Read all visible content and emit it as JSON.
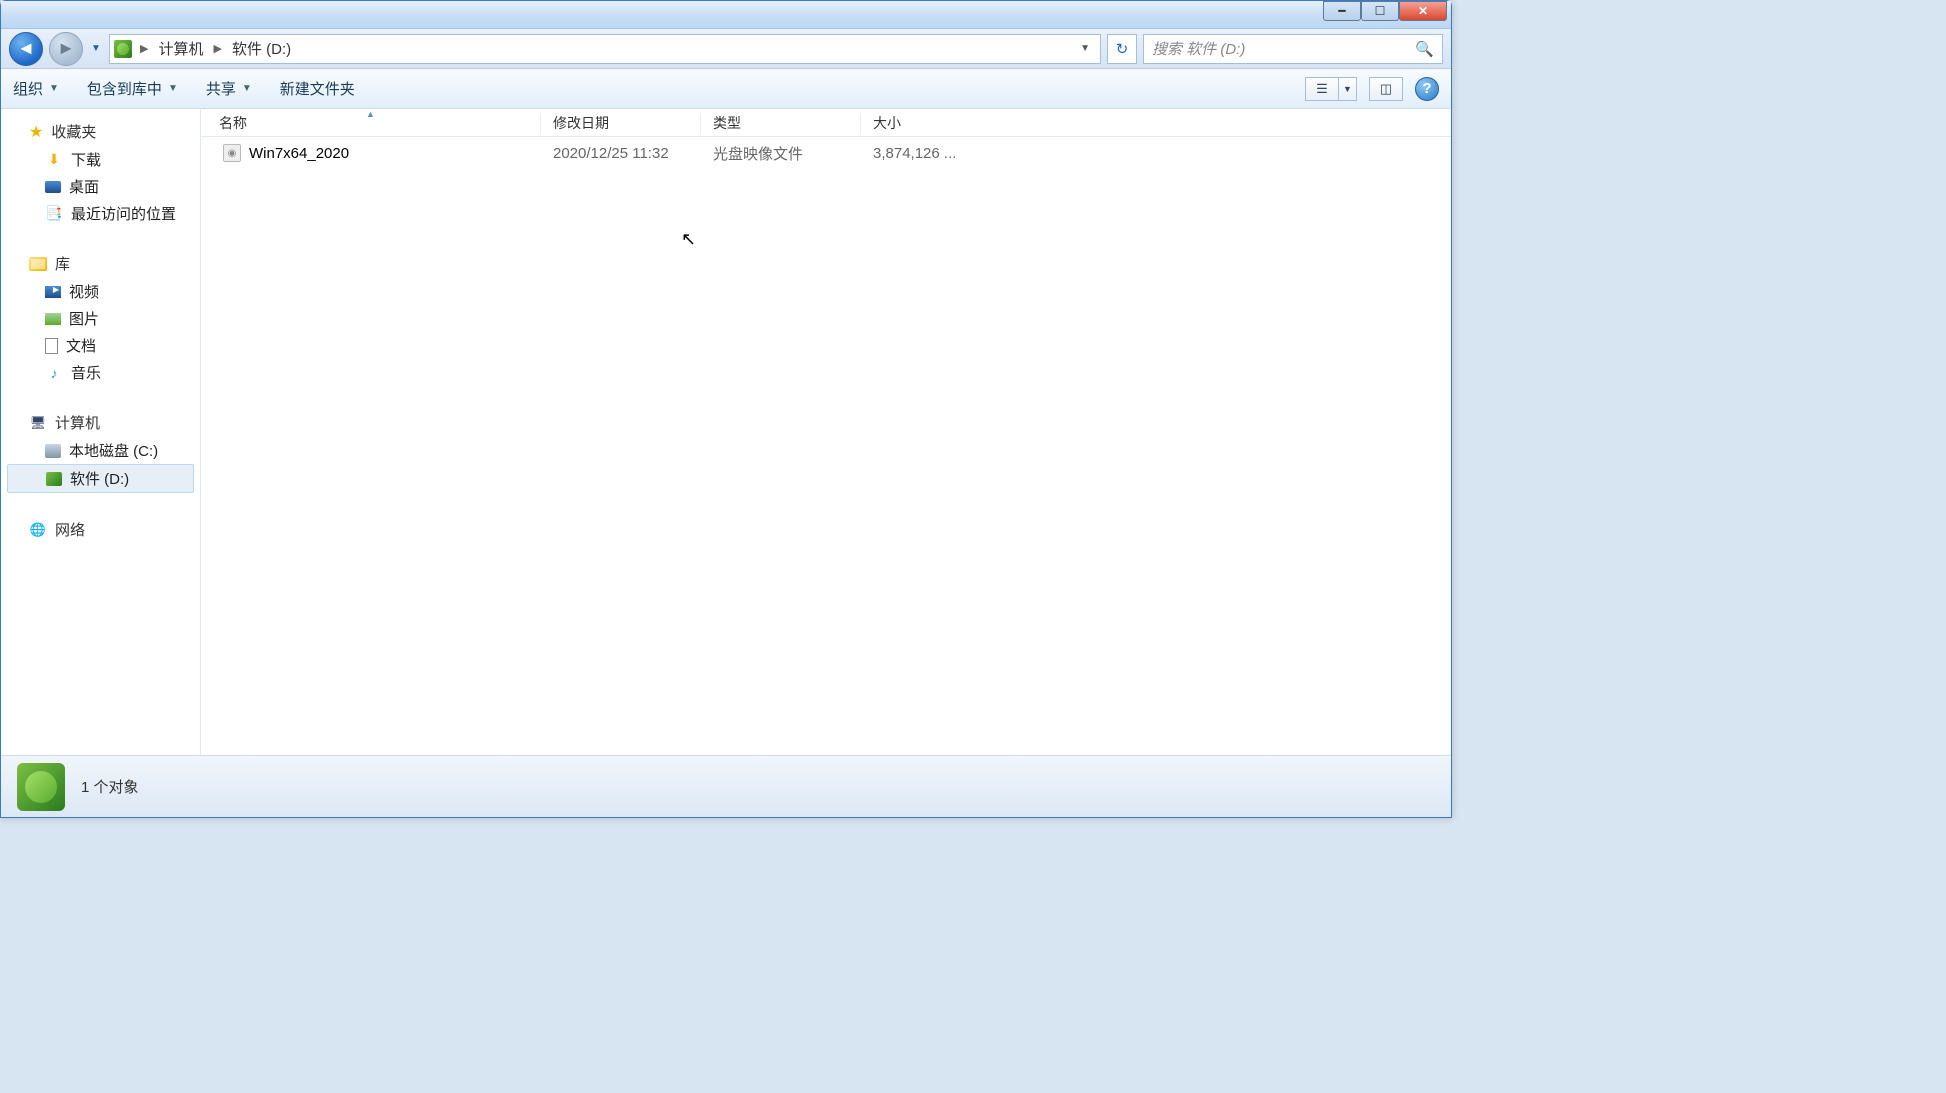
{
  "breadcrumb": {
    "seg1": "计算机",
    "seg2": "软件 (D:)"
  },
  "search": {
    "placeholder": "搜索 软件 (D:)"
  },
  "toolbar": {
    "organize": "组织",
    "include": "包含到库中",
    "share": "共享",
    "newfolder": "新建文件夹"
  },
  "columns": {
    "name": "名称",
    "date": "修改日期",
    "type": "类型",
    "size": "大小"
  },
  "sidebar": {
    "favorites": "收藏夹",
    "downloads": "下载",
    "desktop": "桌面",
    "recent": "最近访问的位置",
    "libraries": "库",
    "videos": "视频",
    "pictures": "图片",
    "documents": "文档",
    "music": "音乐",
    "computer": "计算机",
    "drive_c": "本地磁盘 (C:)",
    "drive_d": "软件 (D:)",
    "network": "网络"
  },
  "file": {
    "name": "Win7x64_2020",
    "date": "2020/12/25 11:32",
    "type": "光盘映像文件",
    "size": "3,874,126 ..."
  },
  "status": {
    "count": "1 个对象"
  }
}
